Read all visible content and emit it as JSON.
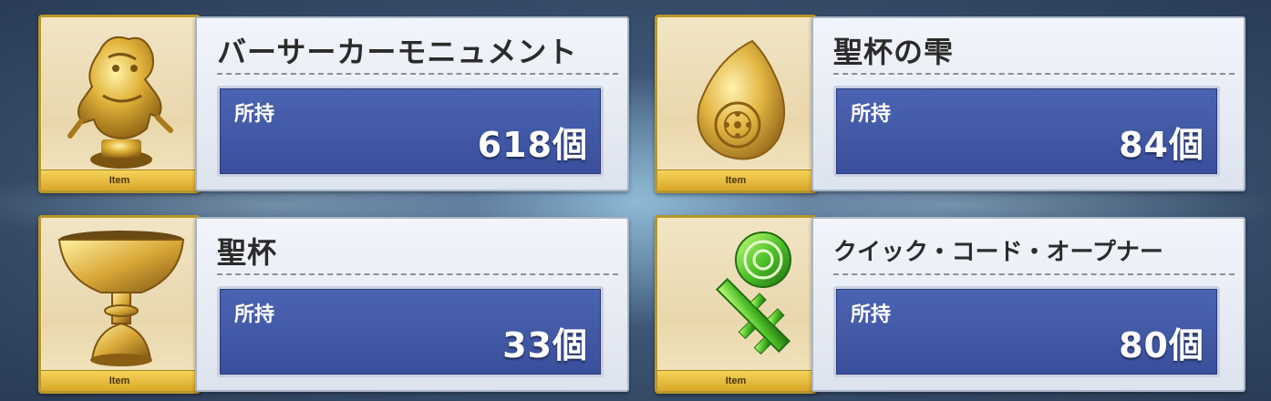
{
  "items": [
    {
      "name": "バーサーカーモニュメント",
      "holdings_label": "所持",
      "count": "618個",
      "tag": "Item",
      "icon": "berserker-monument-icon"
    },
    {
      "name": "聖杯の雫",
      "holdings_label": "所持",
      "count": "84個",
      "tag": "Item",
      "icon": "grail-drop-icon"
    },
    {
      "name": "聖杯",
      "holdings_label": "所持",
      "count": "33個",
      "tag": "Item",
      "icon": "holy-grail-icon"
    },
    {
      "name": "クイック・コード・オープナー",
      "holdings_label": "所持",
      "count": "80個",
      "tag": "Item",
      "icon": "quick-code-opener-icon"
    }
  ],
  "colors": {
    "holdings_panel": "#4559a8",
    "item_tag": "#e6bb3c",
    "frame_gold": "#b8962e"
  }
}
